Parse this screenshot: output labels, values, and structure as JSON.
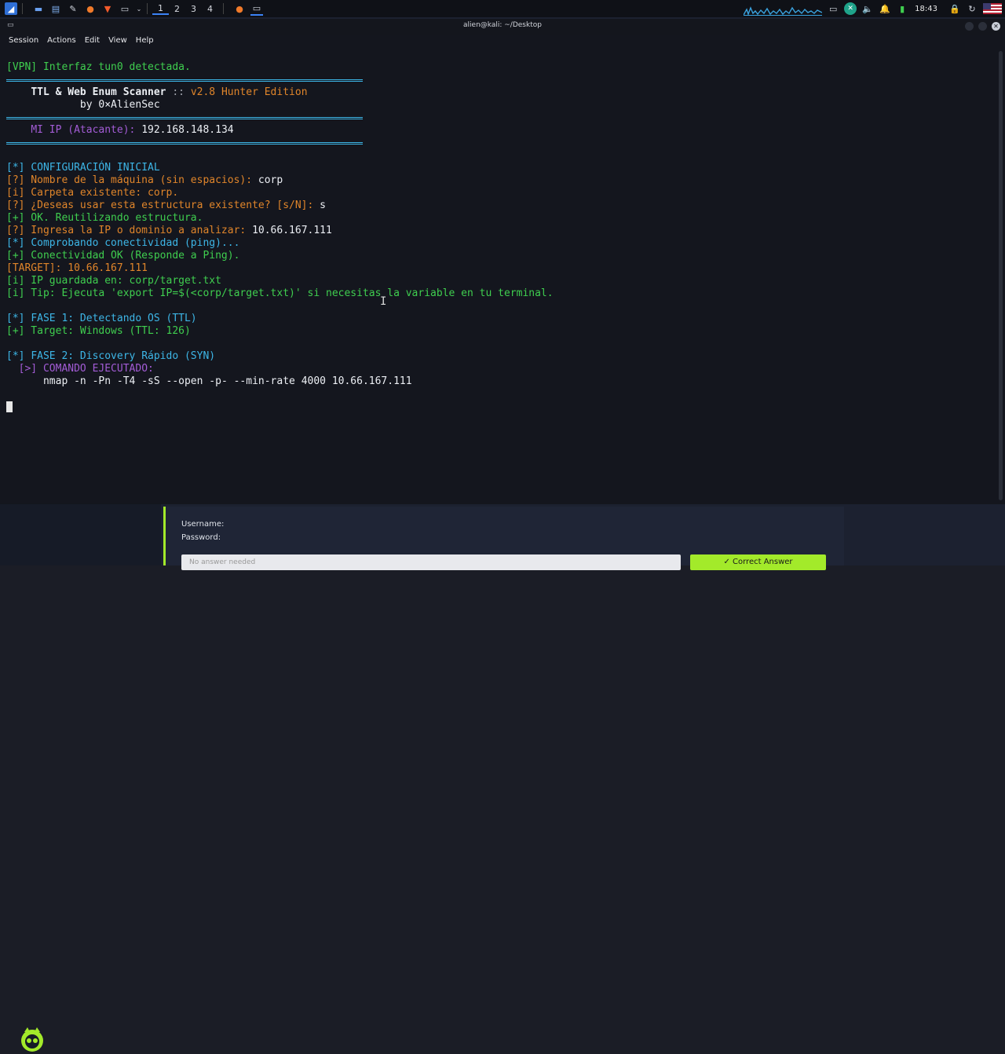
{
  "taskbar": {
    "workspaces": [
      "1",
      "2",
      "3",
      "4"
    ],
    "clock": "18:43"
  },
  "window": {
    "title": "alien@kali: ~/Desktop",
    "menu": [
      "Session",
      "Actions",
      "Edit",
      "View",
      "Help"
    ]
  },
  "terminal": {
    "l_vpn": "[VPN] Interfaz tun0 detectada.",
    "banner_title": "TTL & Web Enum Scanner",
    "banner_sep": " :: ",
    "banner_version": "v2.8 Hunter Edition",
    "banner_by": "by 0×AlienSec",
    "ip_label": "MI IP (Atacante):",
    "ip_value": "192.168.148.134",
    "cfg_mark": "[*]",
    "cfg_text": "CONFIGURACIÓN INICIAL",
    "q1_prompt": "[?] Nombre de la máquina (sin espacios):",
    "q1_answer": "corp",
    "i1": "[i] Carpeta existente: corp.",
    "q2_prompt": "[?] ¿Deseas usar esta estructura existente? [s/N]:",
    "q2_answer": "s",
    "ok1": "[+] OK. Reutilizando estructura.",
    "q3_prompt": "[?] Ingresa la IP o dominio a analizar:",
    "q3_answer": "10.66.167.111",
    "ping_mark": "[*]",
    "ping_text": "Comprobando conectividad (ping)...",
    "ok2": "[+] Conectividad OK (Responde a Ping).",
    "target": "[TARGET]: 10.66.167.111",
    "i2": "[i] IP guardada en: corp/target.txt",
    "i3": "[i] Tip: Ejecuta 'export IP=$(<corp/target.txt)' si necesitas la variable en tu terminal.",
    "f1_mark": "[*]",
    "f1_text": "FASE 1: Detectando OS (TTL)",
    "f1_result": "[+] Target: Windows (TTL: 126)",
    "f2_mark": "[*]",
    "f2_text": "FASE 2: Discovery Rápido (SYN)",
    "cmd_label": "[>] COMANDO EJECUTADO:",
    "cmd": "nmap -n -Pn -T4 -sS --open -p- --min-rate 4000 10.66.167.111"
  },
  "background_page": {
    "username_label": "Username:",
    "password_label": "Password:",
    "answer_placeholder": "No answer needed",
    "correct_button": "✓ Correct Answer"
  },
  "colors": {
    "cyan": "#3db6e7",
    "orange": "#e0852a",
    "green": "#3fce4f",
    "accent_lime": "#a3ea2a"
  }
}
